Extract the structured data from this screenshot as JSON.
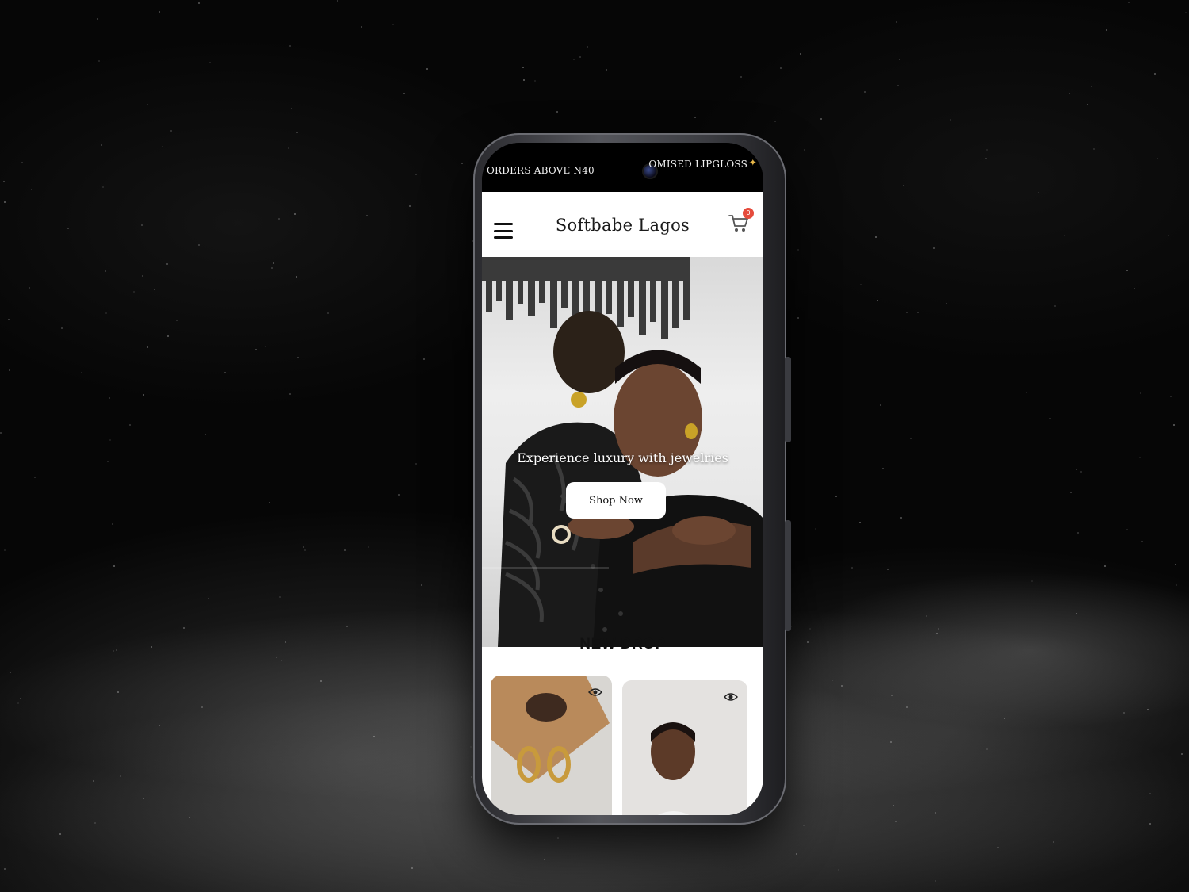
{
  "announcement": {
    "left_text": "ORDERS ABOVE N40",
    "right_text": "OMISED LIPGLOSS"
  },
  "header": {
    "brand": "Softbabe Lagos",
    "cart_count": "0"
  },
  "hero": {
    "headline": "Experience luxury with jewelries",
    "cta_label": "Shop Now"
  },
  "products": {
    "section_title": "NEW DROP",
    "items": [
      {
        "icon": "eye-icon"
      },
      {
        "icon": "eye-icon"
      }
    ]
  },
  "colors": {
    "badge": "#e54b3c",
    "accent": "#e8b84a",
    "background": "#060606"
  }
}
